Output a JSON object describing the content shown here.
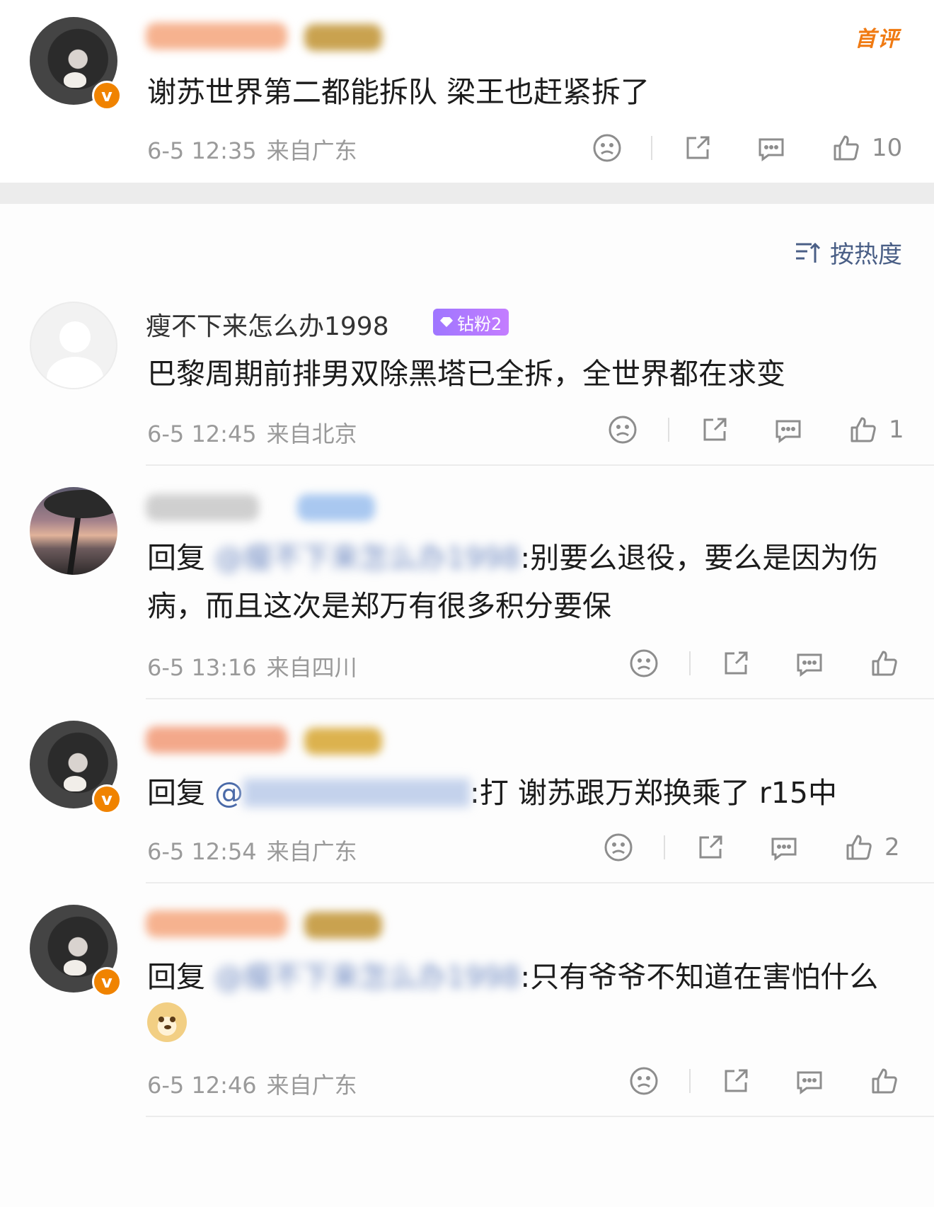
{
  "sort_label": "按热度",
  "first_badge": "首评",
  "comments": [
    {
      "id": "c0",
      "avatar": "cat",
      "verified": true,
      "verified_mark": "v",
      "name": "",
      "text": "谢苏世界第二都能拆队 梁王也赶紧拆了",
      "time": "6-5 12:35",
      "location": "来自广东",
      "likes": "10"
    },
    {
      "id": "c1",
      "avatar": "default",
      "verified": false,
      "name": "瘦不下来怎么办1998",
      "fan_badge": "钻粉2",
      "text": "巴黎周期前排男双除黑塔已全拆，全世界都在求变",
      "time": "6-5 12:45",
      "location": "来自北京",
      "likes": "1"
    },
    {
      "id": "c2",
      "avatar": "sunset",
      "verified": false,
      "name": "",
      "reply_prefix": "回复",
      "mention": "@瘦不下来怎么办1998",
      "text": ":别要么退役，要么是因为伤病，而且这次是郑万有很多积分要保",
      "time": "6-5 13:16",
      "location": "来自四川",
      "likes": ""
    },
    {
      "id": "c3",
      "avatar": "cat",
      "verified": true,
      "verified_mark": "v",
      "name": "",
      "reply_prefix": "回复",
      "mention": "@",
      "text": ":打 谢苏跟万郑换乘了 r15中",
      "time": "6-5 12:54",
      "location": "来自广东",
      "likes": "2"
    },
    {
      "id": "c4",
      "avatar": "cat",
      "verified": true,
      "verified_mark": "v",
      "name": "",
      "reply_prefix": "回复",
      "mention": "@瘦不下来怎么办1998",
      "text": ":只有爷爷不知道在害怕什么",
      "emoji": "doge",
      "time": "6-5 12:46",
      "location": "来自广东",
      "likes": ""
    }
  ],
  "icons": {
    "dislike": "frown-face-icon",
    "share": "share-icon",
    "comment": "comment-bubble-icon",
    "like": "thumbs-up-icon",
    "sort": "sort-icon"
  },
  "colors": {
    "link": "#4a6aa8",
    "first_badge": "#f07a12",
    "verified": "#f08300",
    "fan_badge": "#a978ff"
  }
}
